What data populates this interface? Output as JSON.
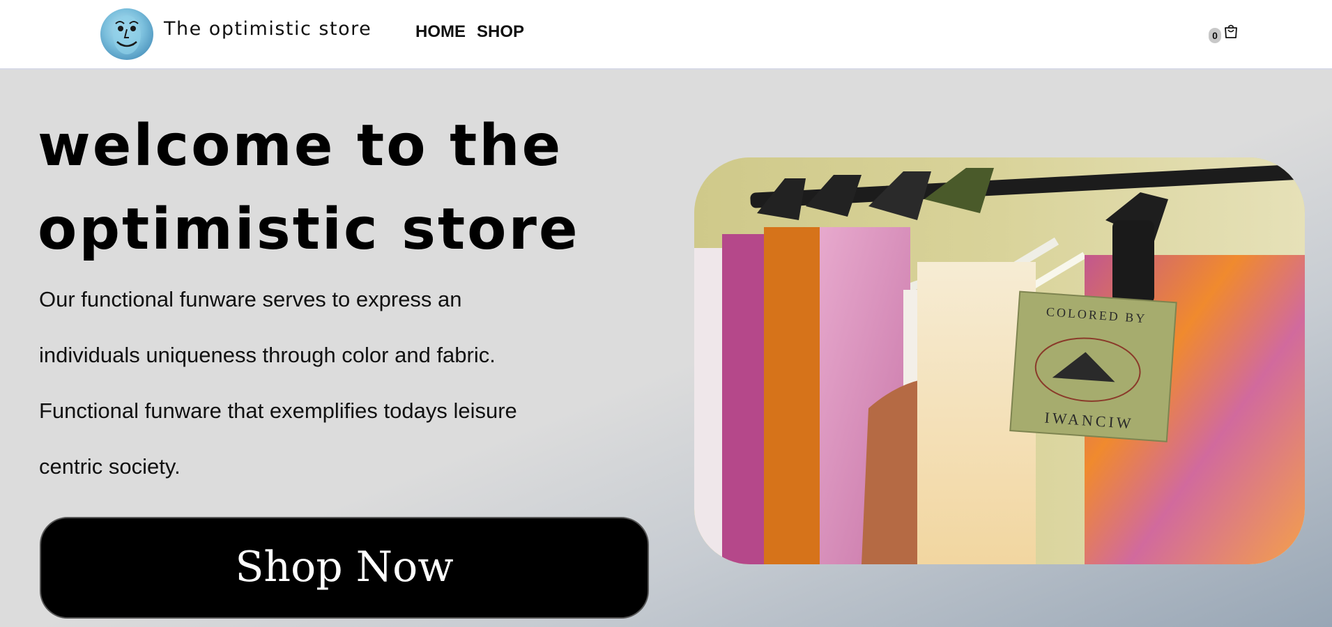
{
  "header": {
    "brand": "The optimistic store",
    "nav": [
      "HOME",
      "SHOP"
    ],
    "cart_count": "0"
  },
  "hero": {
    "headline_line1": "welcome to the",
    "headline_line2": "optimistic store",
    "description_lines": [
      "Our functional funware serves to express an",
      "individuals uniqueness through color and fabric.",
      "Functional funware that exemplifies todays leisure",
      "centric society."
    ],
    "cta_label": "Shop Now",
    "image_tag_top": "COLORED BY",
    "image_tag_bottom": "IWANCIW"
  },
  "colors": {
    "background": "#dcdcdc",
    "header_bg": "#ffffff",
    "button_bg": "#000000",
    "button_text": "#ffffff"
  },
  "icons": [
    "logo-face-icon",
    "shopping-bag-icon"
  ]
}
